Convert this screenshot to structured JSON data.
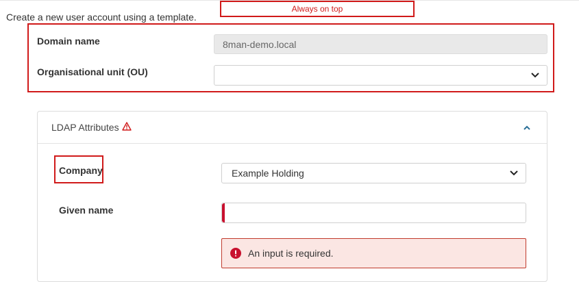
{
  "overlay": {
    "always_on_top_label": "Always on top"
  },
  "intro_text": "Create a new user account using a template.",
  "domain": {
    "label": "Domain name",
    "value": "8man-demo.local"
  },
  "ou": {
    "label": "Organisational unit (OU)",
    "value": ""
  },
  "ldap": {
    "title": "LDAP Attributes",
    "company": {
      "label": "Company",
      "value": "Example Holding"
    },
    "given_name": {
      "label": "Given name",
      "value": ""
    },
    "error": "An input is required."
  },
  "colors": {
    "highlight": "#d01919",
    "error_bg": "#fbe6e3",
    "required_marker": "#c8102e"
  },
  "icons": {
    "warning": "warning-triangle-icon",
    "collapse": "chevron-up-icon",
    "dropdown": "chevron-down-icon",
    "error": "error-circle-icon"
  }
}
